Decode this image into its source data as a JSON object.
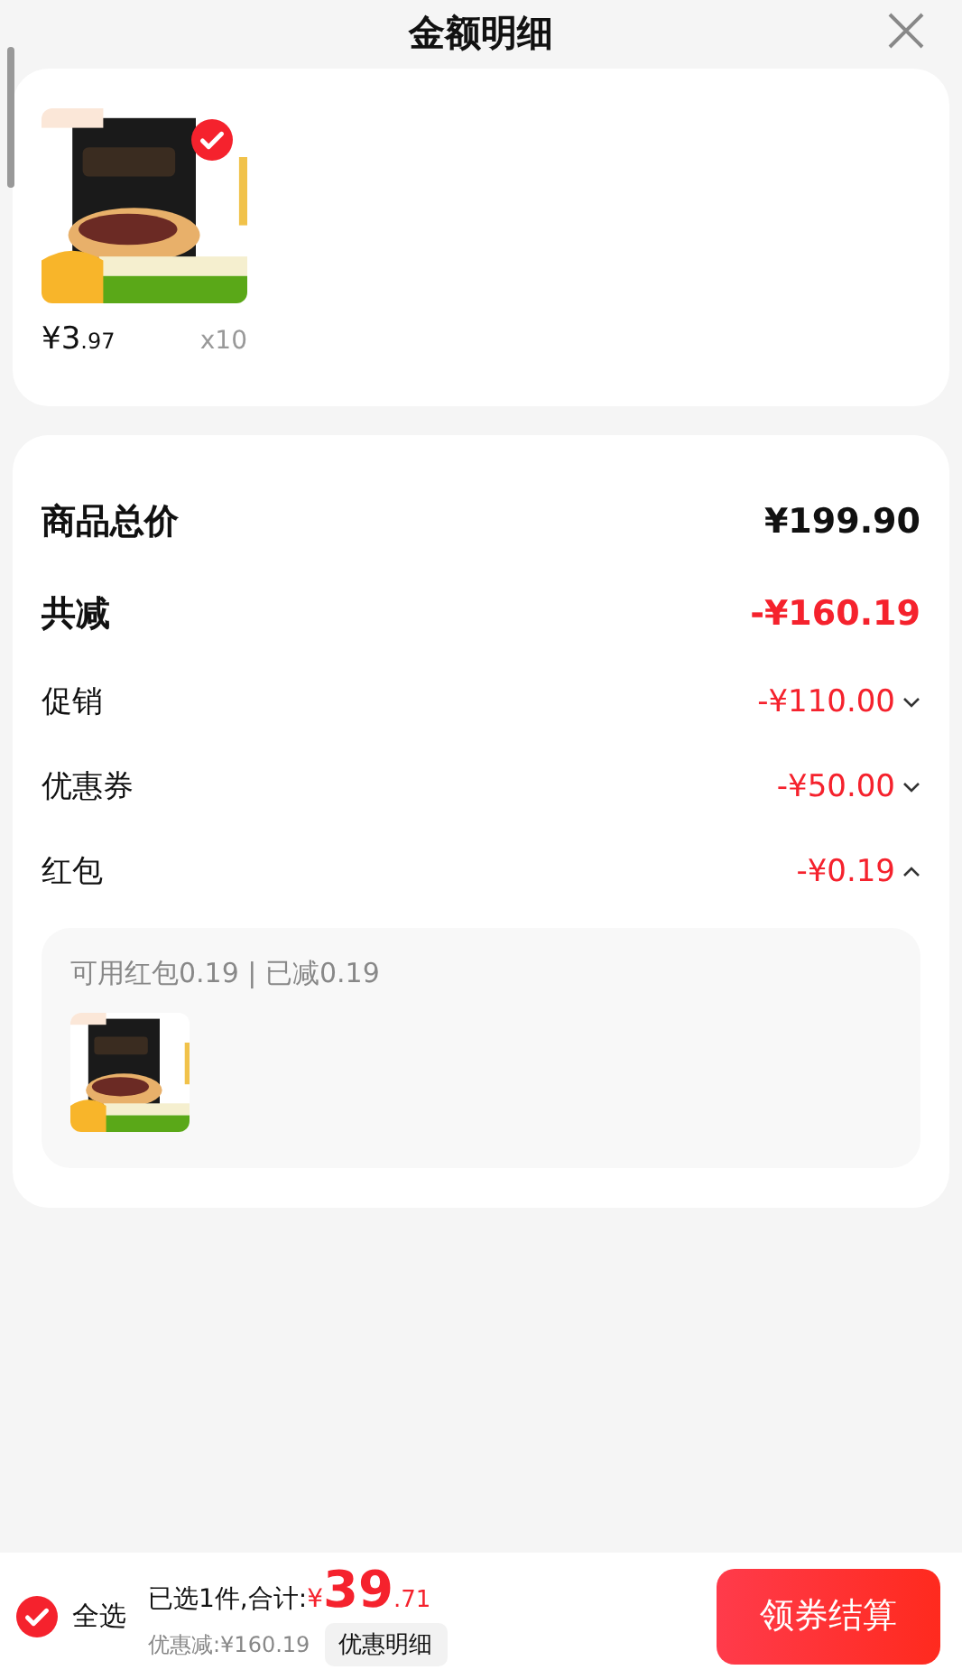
{
  "header": {
    "title": "金额明细"
  },
  "items": [
    {
      "kind": "picture",
      "selected": true,
      "price_int": "¥3",
      "price_dec": ".97",
      "quantity": "x10"
    }
  ],
  "summary": [
    {
      "kind": "total",
      "label": "商品总价",
      "amount": "¥199.90"
    },
    {
      "kind": "discount_total",
      "label": "共减",
      "amount": "-¥160.19"
    },
    {
      "kind": "detail",
      "label": "促销",
      "amount": "-¥110.00",
      "expanded": false
    },
    {
      "kind": "detail",
      "label": "优惠券",
      "amount": "-¥50.00",
      "expanded": false
    },
    {
      "kind": "detail",
      "label": "红包",
      "amount": "-¥0.19",
      "expanded": true
    }
  ],
  "redpacket": {
    "note": "可用红包0.19 | 已减0.19"
  },
  "bottom_bar": {
    "select_all": {
      "label": "全选",
      "checked": true
    },
    "selected_text": "已选1件,合计:",
    "currency": "¥",
    "total_int": "39",
    "total_dec": ".71",
    "discount": "优惠减:¥160.19",
    "details_button": "优惠明细",
    "checkout": "领券结算"
  }
}
